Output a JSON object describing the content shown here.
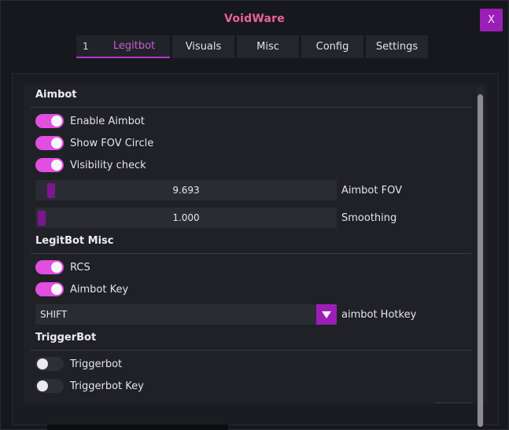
{
  "window": {
    "title": "VoidWare",
    "close_label": "X"
  },
  "tabs": [
    {
      "label": "Legitbot",
      "number": "1",
      "active": true
    },
    {
      "label": "Visuals",
      "active": false
    },
    {
      "label": "Misc",
      "active": false
    },
    {
      "label": "Config",
      "active": false
    },
    {
      "label": "Settings",
      "active": false
    }
  ],
  "aimbot": {
    "title": "Aimbot",
    "enable_aimbot": {
      "label": "Enable Aimbot",
      "on": true
    },
    "show_fov_circle": {
      "label": "Show FOV Circle",
      "on": true
    },
    "visibility_check": {
      "label": "Visibility check",
      "on": true
    },
    "fov_slider": {
      "value": "9.693",
      "label": "Aimbot FOV"
    },
    "smoothing_slider": {
      "value": "1.000",
      "label": "Smoothing"
    }
  },
  "legitbot_misc": {
    "title": "LegitBot Misc",
    "rcs": {
      "label": "RCS",
      "on": true
    },
    "aimbot_key": {
      "label": "Aimbot Key",
      "on": true
    },
    "hotkey": {
      "value": "SHIFT",
      "label": "aimbot Hotkey"
    }
  },
  "triggerbot": {
    "title": "TriggerBot",
    "triggerbot": {
      "label": "Triggerbot",
      "on": false
    },
    "triggerbot_key": {
      "label": "Triggerbot Key",
      "on": false
    }
  },
  "colors": {
    "accent": "#e14ee0",
    "accent_dark": "#9b1fb6",
    "title": "#e9619c"
  }
}
